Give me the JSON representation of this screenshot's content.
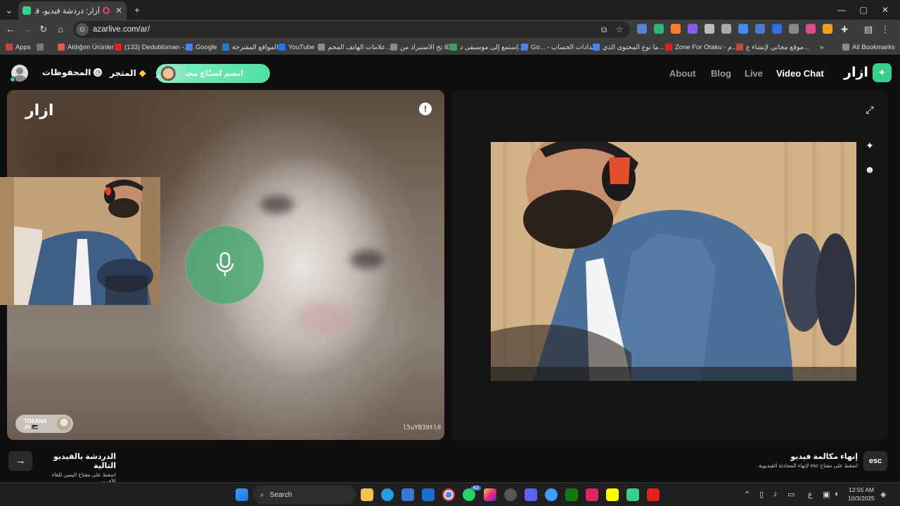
{
  "browser": {
    "tab_title": "أزار: دردشة فيديو، قابل الأصدقاء",
    "new_tab": "+",
    "tab_close": "✕",
    "url": "azarlive.com/ar/",
    "window": {
      "minimize": "—",
      "maximize": "▢",
      "close": "✕"
    },
    "extension_colors": [
      "#5a7fd6",
      "#2bb673",
      "#ff7f2a",
      "#8a5cf6",
      "#bbbbbb",
      "#aaaaaa",
      "#3d8bfd",
      "#4a7bd1",
      "#2f6fe4",
      "#888888",
      "#e04a8a",
      "#f0a020",
      "#bbbbbb"
    ]
  },
  "bookmarks": [
    {
      "label": "Apps",
      "color": "#c6463f"
    },
    {
      "label": "",
      "color": "#777777"
    },
    {
      "label": "Aldığım Ürünler",
      "color": "#e35d3b"
    },
    {
      "label": "(133) Dedublüman -...",
      "color": "#e62117"
    },
    {
      "label": "Google",
      "color": "#4285f4"
    },
    {
      "label": "المواقع المقترحة",
      "color": "#1e7fd6"
    },
    {
      "label": "YouTube",
      "color": "#1877f2"
    },
    {
      "label": "علامات الهاتف المحم...",
      "color": "#8a8a8a"
    },
    {
      "label": "تخ الاستيراد من IE",
      "color": "#8a8a8a"
    },
    {
      "label": "إستمع إلى موسيقى د...",
      "color": "#34a853"
    },
    {
      "label": "Go... - إعدادات الحساب",
      "color": "#4285f4"
    },
    {
      "label": "ما نوع المحتوى الذي...",
      "color": "#4285f4"
    },
    {
      "label": "Zone For Otaku - م...",
      "color": "#e62117"
    },
    {
      "label": "موقع مجاني لإنشاء ع...",
      "color": "#c6463f"
    },
    {
      "label": "»",
      "color": ""
    },
    {
      "label": "All Bookmarks",
      "color": "#8a8a8a"
    }
  ],
  "page": {
    "nav_saved": "المحفوظات",
    "nav_store": "المتجر",
    "banner_text": "انضم لصنّاع محتوى ازار",
    "nav_about": "About",
    "nav_blog": "Blog",
    "nav_live": "Live",
    "nav_video_chat": "Video Chat",
    "logo_text": "ازار",
    "left_logo": "ازار",
    "report_icon": "!",
    "partner_name": "TOFANA",
    "partner_sub": "JO 🇯🇴",
    "user_id": "l5uYB39tl0",
    "next_title": "الدردشة بالفيديو التالية",
    "next_hint": "اضغط على مفتاح اليمين للقاء الآخرين",
    "end_title": "إنهاء مكالمة فيديو",
    "end_hint": "اضغط على مفتاح esc لإنهاء المحادثة الفيديوية.",
    "esc_key": "esc",
    "next_arrow": "→"
  },
  "taskbar": {
    "search_placeholder": "Search",
    "whatsapp_badge": "42",
    "lang": "ع",
    "time": "12:55 AM",
    "date": "10/3/2025"
  }
}
